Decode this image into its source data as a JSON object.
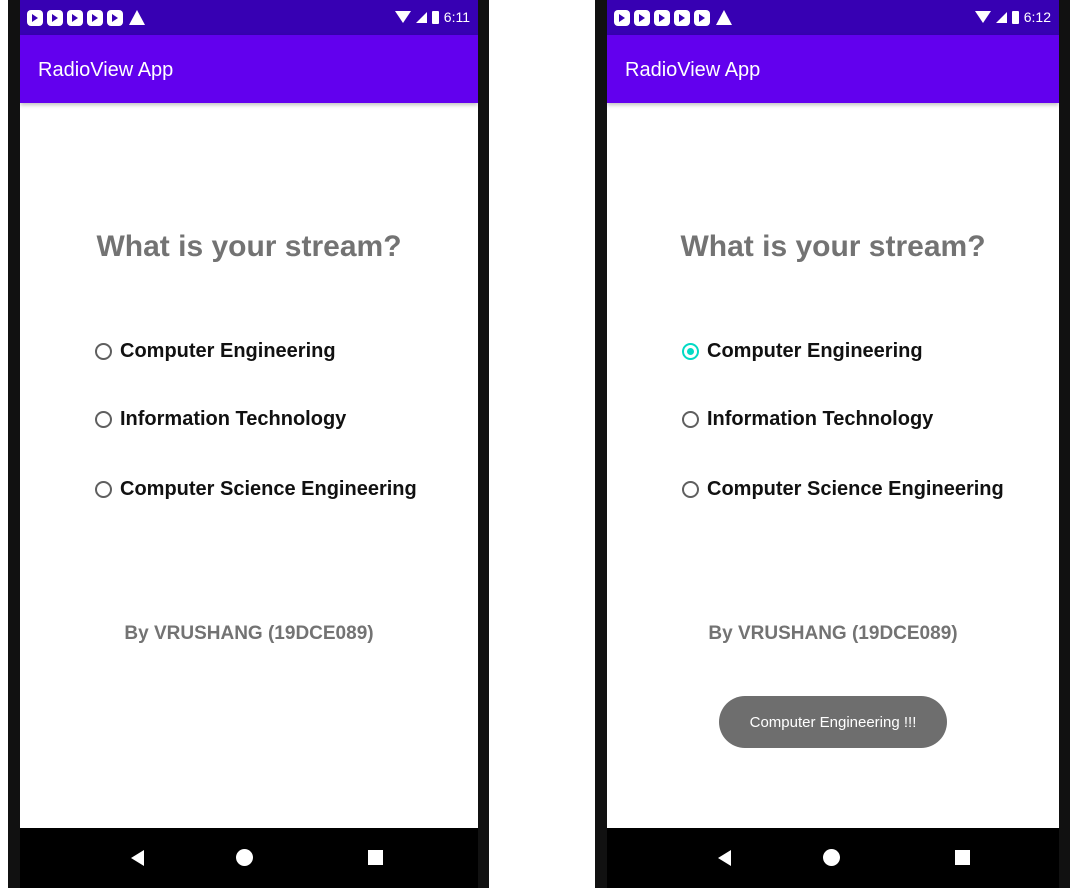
{
  "screens": [
    {
      "status_time": "6:11",
      "app_title": "RadioView App",
      "question": "What is your stream?",
      "options": [
        {
          "label": "Computer Engineering",
          "checked": false
        },
        {
          "label": "Information Technology",
          "checked": false
        },
        {
          "label": "Computer Science Engineering",
          "checked": false
        }
      ],
      "byline": "By VRUSHANG (19DCE089)"
    },
    {
      "status_time": "6:12",
      "app_title": "RadioView App",
      "question": "What is your stream?",
      "options": [
        {
          "label": "Computer Engineering",
          "checked": true
        },
        {
          "label": "Information Technology",
          "checked": false
        },
        {
          "label": "Computer Science Engineering",
          "checked": false
        }
      ],
      "byline": "By VRUSHANG (19DCE089)",
      "toast": "Computer Engineering !!!"
    }
  ],
  "colors": {
    "status_bar": "#3700b3",
    "app_bar": "#6200ee",
    "radio_checked": "#03dac5",
    "toast_bg": "#6e6e6e"
  },
  "icons": {
    "notifications": [
      "play-notification-icon",
      "play-notification-icon",
      "play-notification-icon",
      "play-notification-icon",
      "play-notification-icon",
      "warning-icon"
    ],
    "status": [
      "wifi-icon",
      "signal-icon",
      "battery-icon"
    ],
    "navigation": [
      "back-icon",
      "home-icon",
      "recents-icon"
    ]
  }
}
